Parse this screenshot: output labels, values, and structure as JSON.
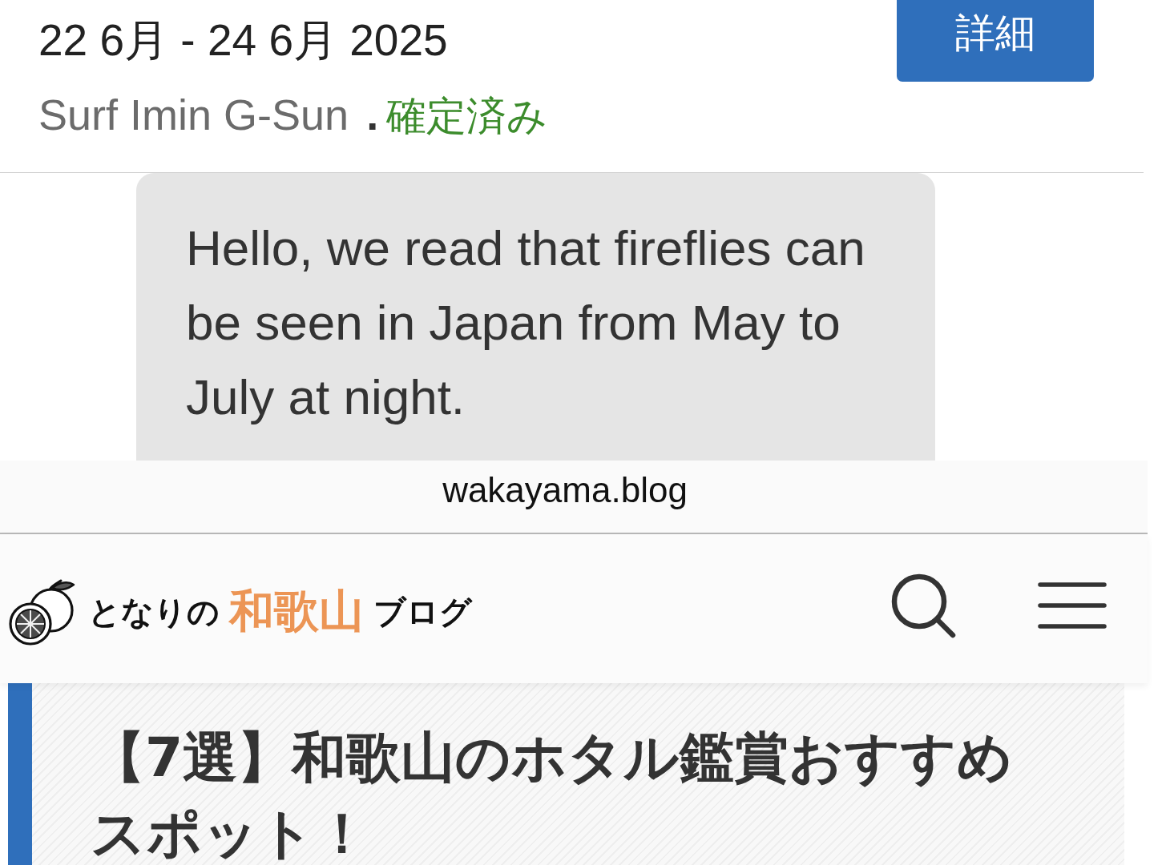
{
  "booking": {
    "dates": "22 6月 - 24 6月 2025",
    "host": "Surf Imin G-Sun",
    "separator": ".",
    "status": {
      "text": "確定済み",
      "kind": "confirmed"
    },
    "details_button": "詳細"
  },
  "message": {
    "text": "Hello, we read that fireflies can be seen in Japan from May to July at night."
  },
  "browser": {
    "address": "wakayama.blog"
  },
  "site_header": {
    "logo": [
      {
        "text": "となりの",
        "kind": "plain"
      },
      {
        "text": "和歌山",
        "kind": "accent"
      },
      {
        "text": "ブログ",
        "kind": "plain"
      }
    ]
  },
  "article": {
    "title": "【7選】和歌山のホタル鑑賞おすすめスポット！"
  }
}
